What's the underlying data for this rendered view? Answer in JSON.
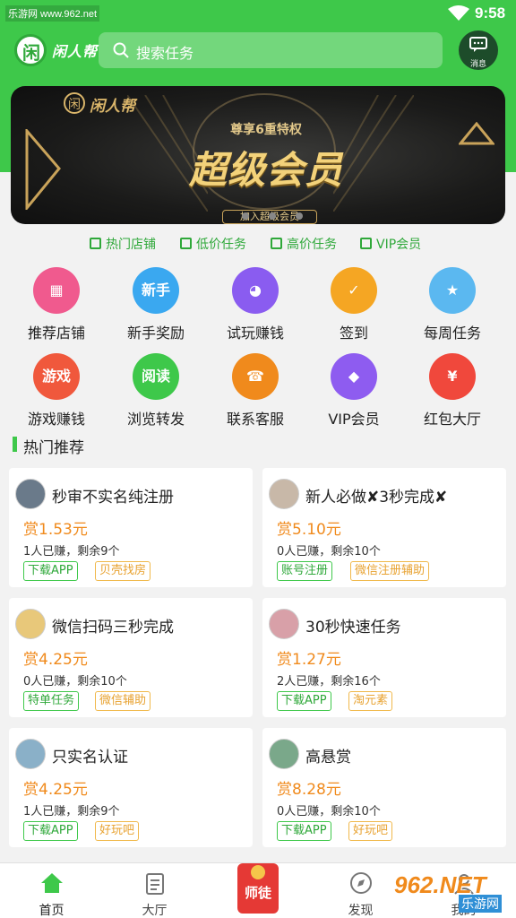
{
  "status_bar": {
    "source_label": "乐游网 www.962.net",
    "time": "9:58"
  },
  "header": {
    "brand": "闲人帮",
    "logo_char": "闲",
    "search_placeholder": "搜索任务",
    "message_label": "消息"
  },
  "banner": {
    "brand": "闲人帮",
    "subtitle": "尊享6重特权",
    "headline": "超级会员",
    "button": "加入超级会员",
    "page_count": 3
  },
  "quick_links": [
    {
      "label": "热门店铺",
      "icon": "shop-list-icon"
    },
    {
      "label": "低价任务",
      "icon": "document-icon"
    },
    {
      "label": "高价任务",
      "icon": "list-icon"
    },
    {
      "label": "VIP会员",
      "icon": "crown-icon"
    }
  ],
  "grid": [
    {
      "label": "推荐店铺",
      "glyph": "▦",
      "color": "#f05a8e",
      "icon": "store-icon"
    },
    {
      "label": "新手奖励",
      "glyph": "新手",
      "color": "#3aa8f0",
      "icon": "newbie-icon"
    },
    {
      "label": "试玩赚钱",
      "glyph": "◕",
      "color": "#8a5cf0",
      "icon": "game-pad-icon"
    },
    {
      "label": "签到",
      "glyph": "✓",
      "color": "#f5a623",
      "icon": "checkin-icon"
    },
    {
      "label": "每周任务",
      "glyph": "★",
      "color": "#5bb8f0",
      "icon": "weekly-icon"
    },
    {
      "label": "游戏赚钱",
      "glyph": "游戏",
      "color": "#f0583c",
      "icon": "gamepad-icon"
    },
    {
      "label": "浏览转发",
      "glyph": "阅读",
      "color": "#3ec84a",
      "icon": "read-icon"
    },
    {
      "label": "联系客服",
      "glyph": "☎",
      "color": "#f08a1c",
      "icon": "headset-icon"
    },
    {
      "label": "VIP会员",
      "glyph": "◆",
      "color": "#8e5cf0",
      "icon": "diamond-icon"
    },
    {
      "label": "红包大厅",
      "glyph": "¥",
      "color": "#f0483c",
      "icon": "red-packet-icon"
    }
  ],
  "hot_title": "热门推荐",
  "tasks": [
    {
      "title": "秒审不实名纯注册",
      "price": "赏1.53元",
      "stat": "1人已赚，剩余9个",
      "tags": [
        "下载APP",
        "贝壳找房"
      ],
      "avatar": "#6a7a8a"
    },
    {
      "title": "新人必做✘3秒完成✘",
      "price": "赏5.10元",
      "stat": "0人已赚，剩余10个",
      "tags": [
        "账号注册",
        "微信注册辅助"
      ],
      "avatar": "#c8b8a8"
    },
    {
      "title": "微信扫码三秒完成",
      "price": "赏4.25元",
      "stat": "0人已赚，剩余10个",
      "tags": [
        "特单任务",
        "微信辅助"
      ],
      "avatar": "#e8c87a"
    },
    {
      "title": "30秒快速任务",
      "price": "赏1.27元",
      "stat": "2人已赚，剩余16个",
      "tags": [
        "下载APP",
        "淘元素"
      ],
      "avatar": "#d8a0a8"
    },
    {
      "title": "只实名认证",
      "price": "赏4.25元",
      "stat": "1人已赚，剩余9个",
      "tags": [
        "下载APP",
        "好玩吧"
      ],
      "avatar": "#8ab0c8"
    },
    {
      "title": "高悬赏",
      "price": "赏8.28元",
      "stat": "0人已赚，剩余10个",
      "tags": [
        "下载APP",
        "好玩吧"
      ],
      "avatar": "#7aa88a"
    }
  ],
  "tabbar": {
    "home": "首页",
    "hall": "大厅",
    "center": "师徒",
    "discover": "发现",
    "mine": "我的"
  },
  "watermark": {
    "text": "962.NET",
    "sub": "乐游网"
  },
  "colors": {
    "brand_green": "#3ec84a",
    "price_orange": "#f08a1c"
  }
}
